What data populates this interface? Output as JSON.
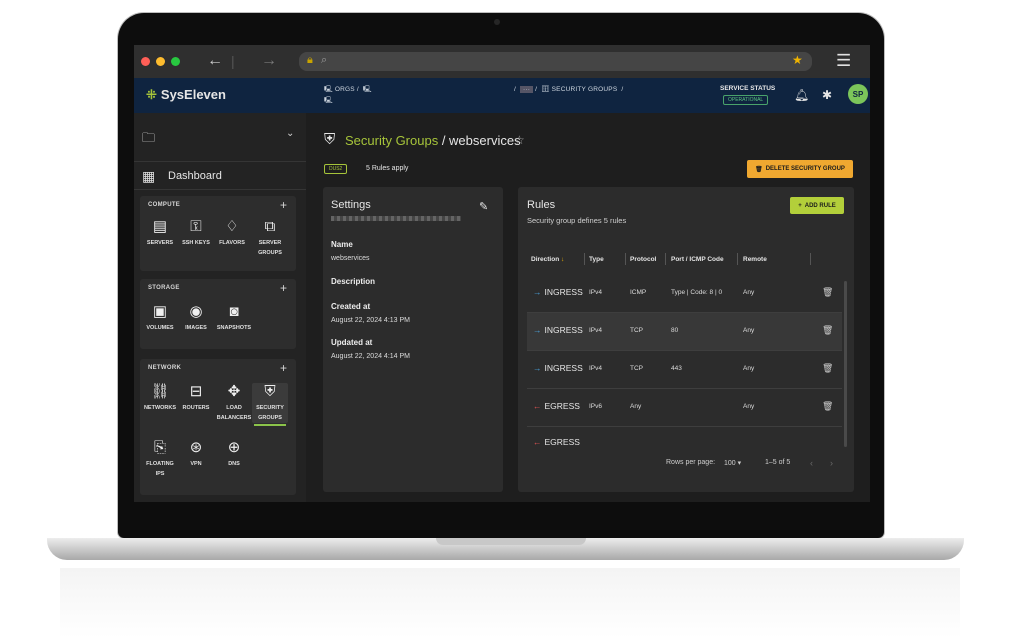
{
  "browser": {
    "back_icon": "arrow-left-icon",
    "forward_icon": "arrow-right-icon",
    "colors": {
      "close": "#ff5f57",
      "minimize": "#febc2e",
      "zoom": "#28c840"
    }
  },
  "header": {
    "brand": "SysEleven",
    "crumb_orgs": "ORGS",
    "crumb_security_groups": "SECURITY GROUPS",
    "service_status_label": "SERVICE STATUS",
    "service_status_value": "OPERATIONAL",
    "avatar_initials": "SP"
  },
  "sidebar": {
    "dashboard_label": "Dashboard",
    "compute": {
      "title": "COMPUTE",
      "items": [
        {
          "label": "SERVERS",
          "icon": "server-icon"
        },
        {
          "label": "SSH KEYS",
          "icon": "key-icon"
        },
        {
          "label": "FLAVORS",
          "icon": "flavor-icon"
        },
        {
          "label": "SERVER GROUPS",
          "icon": "server-group-icon"
        }
      ]
    },
    "storage": {
      "title": "STORAGE",
      "items": [
        {
          "label": "VOLUMES",
          "icon": "volume-icon"
        },
        {
          "label": "IMAGES",
          "icon": "image-disc-icon"
        },
        {
          "label": "SNAPSHOTS",
          "icon": "camera-icon"
        }
      ]
    },
    "network": {
      "title": "NETWORK",
      "items": [
        {
          "label": "NETWORKS",
          "icon": "network-icon"
        },
        {
          "label": "ROUTERS",
          "icon": "router-icon"
        },
        {
          "label": "LOAD BALANCERS",
          "icon": "load-balancer-icon"
        },
        {
          "label": "SECURITY GROUPS",
          "icon": "security-group-icon",
          "active": true
        },
        {
          "label": "FLOATING IPS",
          "icon": "floating-ip-icon"
        },
        {
          "label": "VPN",
          "icon": "vpn-icon"
        },
        {
          "label": "DNS",
          "icon": "globe-icon"
        }
      ]
    }
  },
  "main": {
    "title_section": "Security Groups",
    "title_separator": " / ",
    "title_name": "webservices",
    "region": "DUS2",
    "rules_apply": "5 Rules apply",
    "delete_label": "DELETE SECURITY GROUP",
    "settings": {
      "title": "Settings",
      "name_label": "Name",
      "name_value": "webservices",
      "description_label": "Description",
      "created_label": "Created at",
      "created_value": "August 22, 2024 4:13 PM",
      "updated_label": "Updated at",
      "updated_value": "August 22, 2024 4:14 PM"
    },
    "rules": {
      "title": "Rules",
      "subtitle": "Security group defines 5 rules",
      "add_label": "ADD RULE",
      "columns": [
        "Direction",
        "Type",
        "Protocol",
        "Port / ICMP Code",
        "Remote"
      ],
      "rows": [
        {
          "direction": "INGRESS",
          "type": "IPv4",
          "protocol": "ICMP",
          "port": "Type | Code: 8 | 0",
          "remote": "Any"
        },
        {
          "direction": "INGRESS",
          "type": "IPv4",
          "protocol": "TCP",
          "port": "80",
          "remote": "Any"
        },
        {
          "direction": "INGRESS",
          "type": "IPv4",
          "protocol": "TCP",
          "port": "443",
          "remote": "Any"
        },
        {
          "direction": "EGRESS",
          "type": "IPv6",
          "protocol": "Any",
          "port": "",
          "remote": "Any"
        },
        {
          "direction": "EGRESS",
          "type": "",
          "protocol": "",
          "port": "",
          "remote": ""
        }
      ],
      "rows_per_page_label": "Rows per page:",
      "rows_per_page_value": "100",
      "range": "1–5 of 5"
    }
  }
}
